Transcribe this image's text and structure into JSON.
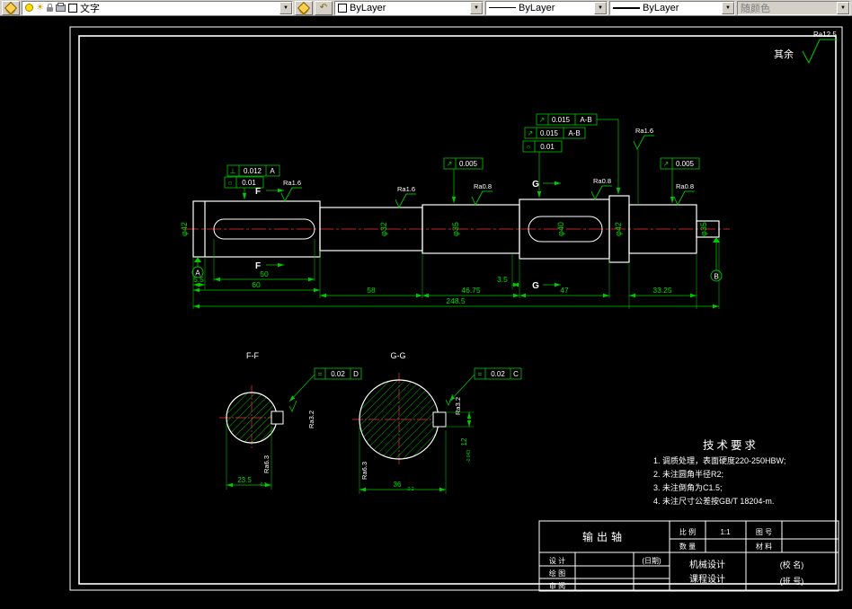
{
  "toolbar": {
    "layer": {
      "value": "文字"
    },
    "color": {
      "value": "ByLayer"
    },
    "linetype": {
      "value": "ByLayer"
    },
    "lineweight": {
      "value": "ByLayer"
    },
    "plot_style": {
      "value": "随颜色"
    }
  },
  "note": {
    "prefix": "其余",
    "value": "Ra12.5"
  },
  "main_view": {
    "diameters": [
      "φ42",
      "φ32",
      "φ35",
      "φ40",
      "φ42",
      "φ35"
    ],
    "dims": [
      "5.5",
      "50",
      "60",
      "58",
      "46.75",
      "3.5",
      "47",
      "33.25",
      "248.5"
    ],
    "frames": [
      {
        "sym": "⊥",
        "val": "0.012",
        "ref": "A"
      },
      {
        "sym": "○",
        "val": "0.01",
        "ref": ""
      },
      {
        "sym": "↗",
        "val": "0.005",
        "ref": ""
      },
      {
        "sym": "↗",
        "val": "0.015",
        "ref": "A-B"
      },
      {
        "sym": "↗",
        "val": "0.015",
        "ref": "A-B"
      },
      {
        "sym": "○",
        "val": "0.01",
        "ref": ""
      },
      {
        "sym": "↗",
        "val": "0.005",
        "ref": ""
      }
    ],
    "roughness": [
      "Ra1.6",
      "Ra1.6",
      "Ra0.8",
      "Ra0.8",
      "Ra1.6",
      "Ra0.8"
    ],
    "section_f": "F",
    "section_g": "G",
    "datum_a": "A",
    "datum_b": "B"
  },
  "section_ff": {
    "title": "F-F",
    "dim": "23.5",
    "dim_tol": "-0.2",
    "frame": {
      "sym": "=",
      "val": "0.02",
      "ref": "D"
    },
    "rough_key": "Ra3.2",
    "rough_face": "Ra6.3"
  },
  "section_gg": {
    "title": "G-G",
    "dim": "36",
    "dim_tol": "-0.2",
    "depth": "12",
    "depth_tol": "-0.043",
    "frame": {
      "sym": "=",
      "val": "0.02",
      "ref": "C"
    },
    "rough_key": "Ra3.2",
    "rough_face": "Ra6.3"
  },
  "tech_req": {
    "title": "技术要求",
    "items": [
      "1. 调质处理，表面硬度220-250HBW;",
      "2. 未注圆角半径R2;",
      "3. 未注倒角为C1.5;",
      "4. 未注尺寸公差按GB/T 18204-m."
    ]
  },
  "title_block": {
    "part_name": "输出轴",
    "scale_label": "比 例",
    "scale_value": "1:1",
    "dwg_label": "图 号",
    "qty_label": "数 量",
    "mat_label": "材 料",
    "design_label": "设 计",
    "date_label": "(日期)",
    "draw_label": "绘 图",
    "check_label": "审 阅",
    "org_line1": "机械设计",
    "org_line2": "课程设计",
    "school": "(校 名)",
    "class_no": "(班 号)"
  }
}
